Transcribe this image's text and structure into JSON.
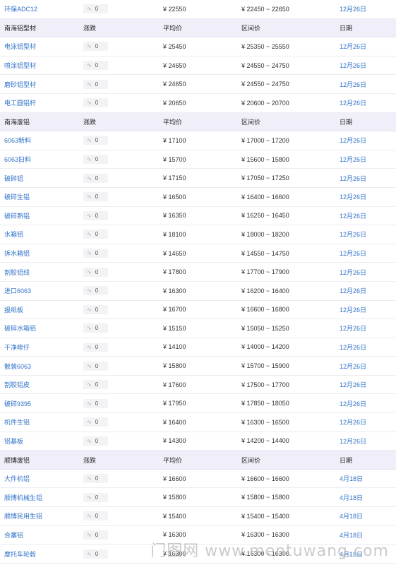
{
  "headers": {
    "change": "涨跌",
    "avg": "平均价",
    "range": "区间价",
    "date": "日期"
  },
  "change_label": "0",
  "wave_glyph": "∿",
  "rows": [
    {
      "type": "item",
      "name": "环保ADC12",
      "avg": "¥ 22550",
      "range": "¥ 22450 ~ 22650",
      "date": "12月26日"
    },
    {
      "type": "section",
      "name": "南海铝型材"
    },
    {
      "type": "item",
      "name": "电泳铝型材",
      "avg": "¥ 25450",
      "range": "¥ 25350 ~ 25550",
      "date": "12月26日"
    },
    {
      "type": "item",
      "name": "喷涂铝型材",
      "avg": "¥ 24650",
      "range": "¥ 24550 ~ 24750",
      "date": "12月26日"
    },
    {
      "type": "item",
      "name": "磨砂铝型材",
      "avg": "¥ 24650",
      "range": "¥ 24550 ~ 24750",
      "date": "12月26日"
    },
    {
      "type": "item",
      "name": "电工圆铝杆",
      "avg": "¥ 20650",
      "range": "¥ 20600 ~ 20700",
      "date": "12月26日"
    },
    {
      "type": "section",
      "name": "南海废铝"
    },
    {
      "type": "item",
      "name": "6063新料",
      "avg": "¥ 17100",
      "range": "¥ 17000 ~ 17200",
      "date": "12月26日"
    },
    {
      "type": "item",
      "name": "6063旧料",
      "avg": "¥ 15700",
      "range": "¥ 15600 ~ 15800",
      "date": "12月26日"
    },
    {
      "type": "item",
      "name": "破碎铝",
      "avg": "¥ 17150",
      "range": "¥ 17050 ~ 17250",
      "date": "12月26日"
    },
    {
      "type": "item",
      "name": "破碎生铝",
      "avg": "¥ 16500",
      "range": "¥ 16400 ~ 16600",
      "date": "12月26日"
    },
    {
      "type": "item",
      "name": "破碎熟铝",
      "avg": "¥ 16350",
      "range": "¥ 16250 ~ 16450",
      "date": "12月26日"
    },
    {
      "type": "item",
      "name": "水箱铝",
      "avg": "¥ 18100",
      "range": "¥ 18000 ~ 18200",
      "date": "12月26日"
    },
    {
      "type": "item",
      "name": "拆水箱铝",
      "avg": "¥ 14650",
      "range": "¥ 14550 ~ 14750",
      "date": "12月26日"
    },
    {
      "type": "item",
      "name": "割胶铝线",
      "avg": "¥ 17800",
      "range": "¥ 17700 ~ 17900",
      "date": "12月26日"
    },
    {
      "type": "item",
      "name": "进口6063",
      "avg": "¥ 16300",
      "range": "¥ 16200 ~ 16400",
      "date": "12月26日"
    },
    {
      "type": "item",
      "name": "报纸板",
      "avg": "¥ 16700",
      "range": "¥ 16600 ~ 16800",
      "date": "12月26日"
    },
    {
      "type": "item",
      "name": "破碎水箱铝",
      "avg": "¥ 15150",
      "range": "¥ 15050 ~ 15250",
      "date": "12月26日"
    },
    {
      "type": "item",
      "name": "干净喹仔",
      "avg": "¥ 14100",
      "range": "¥ 14000 ~ 14200",
      "date": "12月26日"
    },
    {
      "type": "item",
      "name": "散装6063",
      "avg": "¥ 15800",
      "range": "¥ 15700 ~ 15900",
      "date": "12月26日"
    },
    {
      "type": "item",
      "name": "割胶铝皮",
      "avg": "¥ 17600",
      "range": "¥ 17500 ~ 17700",
      "date": "12月26日"
    },
    {
      "type": "item",
      "name": "破碎9395",
      "avg": "¥ 17950",
      "range": "¥ 17850 ~ 18050",
      "date": "12月26日"
    },
    {
      "type": "item",
      "name": "机件生铝",
      "avg": "¥ 16400",
      "range": "¥ 16300 ~ 16500",
      "date": "12月26日"
    },
    {
      "type": "item",
      "name": "铝基板",
      "avg": "¥ 14300",
      "range": "¥ 14200 ~ 14400",
      "date": "12月26日"
    },
    {
      "type": "section",
      "name": "顺博废铝"
    },
    {
      "type": "item",
      "name": "大件机铝",
      "avg": "¥ 16600",
      "range": "¥ 16600 ~ 16600",
      "date": "4月18日"
    },
    {
      "type": "item",
      "name": "顺博机械生铝",
      "avg": "¥ 15800",
      "range": "¥ 15800 ~ 15800",
      "date": "4月18日"
    },
    {
      "type": "item",
      "name": "顺博民用生铝",
      "avg": "¥ 15400",
      "range": "¥ 15400 ~ 15400",
      "date": "4月18日"
    },
    {
      "type": "item",
      "name": "合塞铝",
      "avg": "¥ 16300",
      "range": "¥ 16300 ~ 16300",
      "date": "4月18日"
    },
    {
      "type": "item",
      "name": "摩托车轮毂",
      "avg": "¥ 16300",
      "range": "¥ 16300 ~ 16300",
      "date": "4月18日"
    }
  ],
  "watermark": "门图网 www.mentuwang.com"
}
